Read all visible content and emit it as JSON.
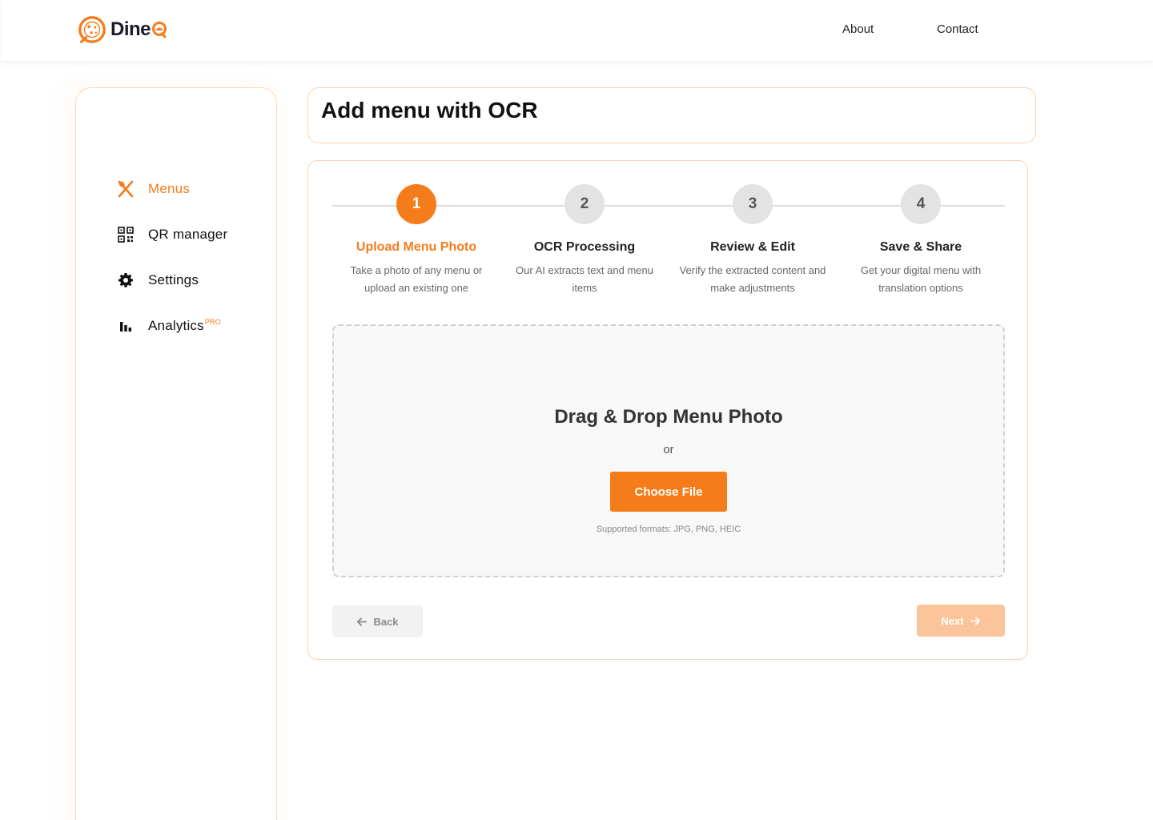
{
  "brand": {
    "name": "Dine",
    "accent": "#f57c1b",
    "logo_icon": "pizza-logo-icon"
  },
  "nav": {
    "about": "About",
    "contact": "Contact"
  },
  "sidebar": {
    "items": [
      {
        "label": "Menus",
        "icon": "utensils-icon",
        "active": true
      },
      {
        "label": "QR manager",
        "icon": "qr-code-icon",
        "active": false
      },
      {
        "label": "Settings",
        "icon": "gear-icon",
        "active": false
      },
      {
        "label": "Analytics",
        "icon": "bar-chart-icon",
        "active": false,
        "badge": "PRO"
      }
    ]
  },
  "page": {
    "title": "Add menu with OCR"
  },
  "steps": [
    {
      "number": "1",
      "title": "Upload Menu Photo",
      "description": "Take a photo of any menu or upload an existing one",
      "active": true
    },
    {
      "number": "2",
      "title": "OCR Processing",
      "description": "Our AI extracts text and menu items",
      "active": false
    },
    {
      "number": "3",
      "title": "Review & Edit",
      "description": "Verify the extracted content and make adjustments",
      "active": false
    },
    {
      "number": "4",
      "title": "Save & Share",
      "description": "Get your digital menu with translation options",
      "active": false
    }
  ],
  "upload": {
    "heading": "Drag & Drop Menu Photo",
    "or": "or",
    "button": "Choose File",
    "formats": "Supported formats: JPG, PNG, HEIC"
  },
  "actions": {
    "back": "Back",
    "next": "Next"
  }
}
